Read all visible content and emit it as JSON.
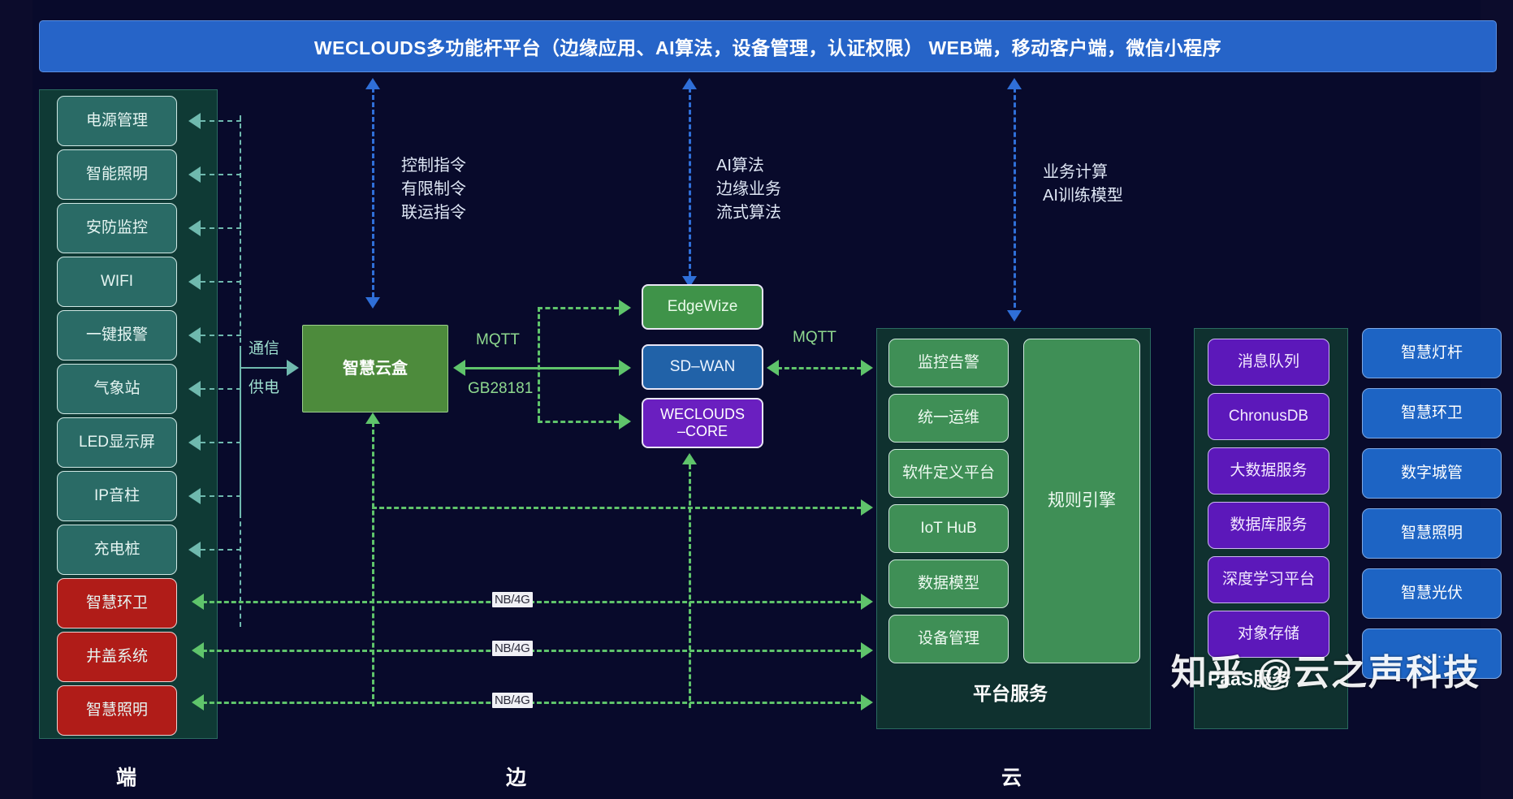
{
  "title": "WECLOUDS多功能杆平台（边缘应用、AI算法，设备管理，认证权限） WEB端，移动客户端，微信小程序",
  "device_column": {
    "items": [
      {
        "label": "电源管理",
        "kind": "teal"
      },
      {
        "label": "智能照明",
        "kind": "teal"
      },
      {
        "label": "安防监控",
        "kind": "teal"
      },
      {
        "label": "WIFI",
        "kind": "teal"
      },
      {
        "label": "一键报警",
        "kind": "teal"
      },
      {
        "label": "气象站",
        "kind": "teal"
      },
      {
        "label": "LED显示屏",
        "kind": "teal"
      },
      {
        "label": "IP音柱",
        "kind": "teal"
      },
      {
        "label": "充电桩",
        "kind": "teal"
      },
      {
        "label": "智慧环卫",
        "kind": "red"
      },
      {
        "label": "井盖系统",
        "kind": "red"
      },
      {
        "label": "智慧照明",
        "kind": "red"
      }
    ]
  },
  "bus_labels": {
    "comm": "通信",
    "power": "供电"
  },
  "edge": {
    "gateway": "智慧云盒",
    "stack": [
      {
        "label": "EdgeWize",
        "color": "#3f9349"
      },
      {
        "label": "SD–WAN",
        "color": "#2162a8"
      },
      {
        "label": "WECLOUDS\n–CORE",
        "color": "#6a1fc0"
      }
    ],
    "protocols": {
      "mqtt_left": "MQTT",
      "gb": "GB28181",
      "mqtt_right": "MQTT"
    },
    "nb4g": [
      "NB/4G",
      "NB/4G",
      "NB/4G"
    ]
  },
  "annotations": {
    "control": "控制指令\n有限制令\n联运指令",
    "ai": "AI算法\n边缘业务\n流式算法",
    "compute": "业务计算\nAI训练模型"
  },
  "platform": {
    "caption": "平台服务",
    "services": [
      "监控告警",
      "统一运维",
      "软件定义平台",
      "IoT HuB",
      "数据模型",
      "设备管理"
    ],
    "rule_engine": "规则引擎"
  },
  "paas": {
    "caption": "PaaS服务",
    "services": [
      "消息队列",
      "ChronusDB",
      "大数据服务",
      "数据库服务",
      "深度学习平台",
      "对象存储"
    ]
  },
  "applications": [
    "智慧灯杆",
    "智慧环卫",
    "数字城管",
    "智慧照明",
    "智慧光伏",
    "……"
  ],
  "tiers": {
    "end": "端",
    "edge": "边",
    "cloud": "云"
  },
  "watermark": "知乎 @云之声科技",
  "colors": {
    "brand_blue": "#2664c8",
    "background": "#080a2b",
    "teal_node": "#2a6b66",
    "red_node": "#b01c18",
    "green_gateway": "#4d8b3c",
    "platform_green": "#3f8f56",
    "paas_purple": "#5c18ba",
    "app_blue": "#1d64c4",
    "panel_dark": "#0f312f",
    "flow_green": "#5fc46b",
    "flow_blue": "#2f6fd8"
  }
}
